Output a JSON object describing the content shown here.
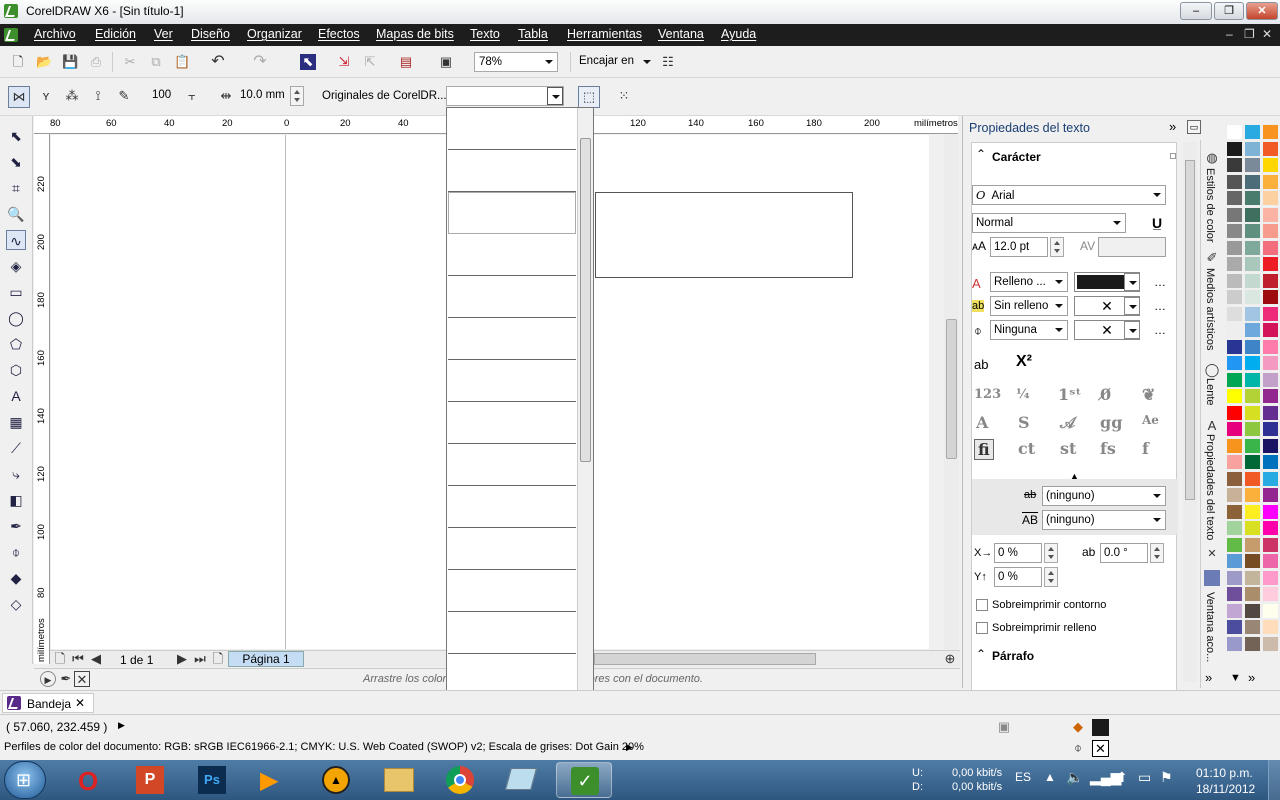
{
  "window": {
    "title": "CorelDRAW X6 - [Sin título-1]",
    "min": "–",
    "max": "❐",
    "close": "✕"
  },
  "menu": [
    "Archivo",
    "Edición",
    "Ver",
    "Diseño",
    "Organizar",
    "Efectos",
    "Mapas de bits",
    "Texto",
    "Tabla",
    "Herramientas",
    "Ventana",
    "Ayuda"
  ],
  "menu_right": {
    "min": "–",
    "restore": "❐",
    "close": "✕"
  },
  "toolbar1": {
    "zoom": "78%",
    "snap": "Encajar en"
  },
  "propbar": {
    "size_value": "100",
    "offset_value": "10.0 mm",
    "brush_label": "Originales de CorelDR..."
  },
  "rulers": {
    "h_numbers": [
      "80",
      "60",
      "40",
      "20",
      "0",
      "20",
      "40",
      "120",
      "140",
      "160",
      "180",
      "200"
    ],
    "h_unit": "milímetros",
    "v_numbers": [
      "220",
      "200",
      "180",
      "160",
      "140",
      "120",
      "100",
      "80"
    ],
    "v_unit": "milímetros"
  },
  "pagenav": {
    "counter": "1 de 1",
    "tab": "Página 1"
  },
  "palette_hint": "Arrastre los colores (o los objetos) ... estos colores con el documento.",
  "docker": {
    "title": "Propiedades del texto",
    "character": "Carácter",
    "font": "Arial",
    "style": "Normal",
    "size": "12.0 pt",
    "fill": "Relleno ...",
    "background": "Sin relleno",
    "outline": "Ninguna",
    "strike": "(ninguno)",
    "caps": "(ninguno)",
    "x_off": "0 %",
    "rotation": "0.0 °",
    "y_off": "0 %",
    "overprint_outline": "Sobreimprimir contorno",
    "overprint_fill": "Sobreimprimir relleno",
    "paragraph": "Párrafo"
  },
  "vtabs": [
    "Estilos de color",
    "Medios artísticos",
    "Lente",
    "Propiedades del texto",
    "Ventana aco..."
  ],
  "bandeja": "Bandeja",
  "status": {
    "coords": "( 57.060, 232.459 )",
    "profile": "Perfiles de color del documento: RGB: sRGB IEC61966-2.1; CMYK: U.S. Web Coated (SWOP) v2; Escala de grises: Dot Gain 20%"
  },
  "taskbar": {
    "up_label": "U:",
    "down_label": "D:",
    "up": "0,00 kbit/s",
    "down": "0,00 kbit/s",
    "lang": "ES",
    "time": "01:10 p.m.",
    "date": "18/11/2012"
  },
  "colors": {
    "accent": "#3c8f2a",
    "menubar": "#1d1d1d",
    "taskbar": "#2e5780"
  }
}
